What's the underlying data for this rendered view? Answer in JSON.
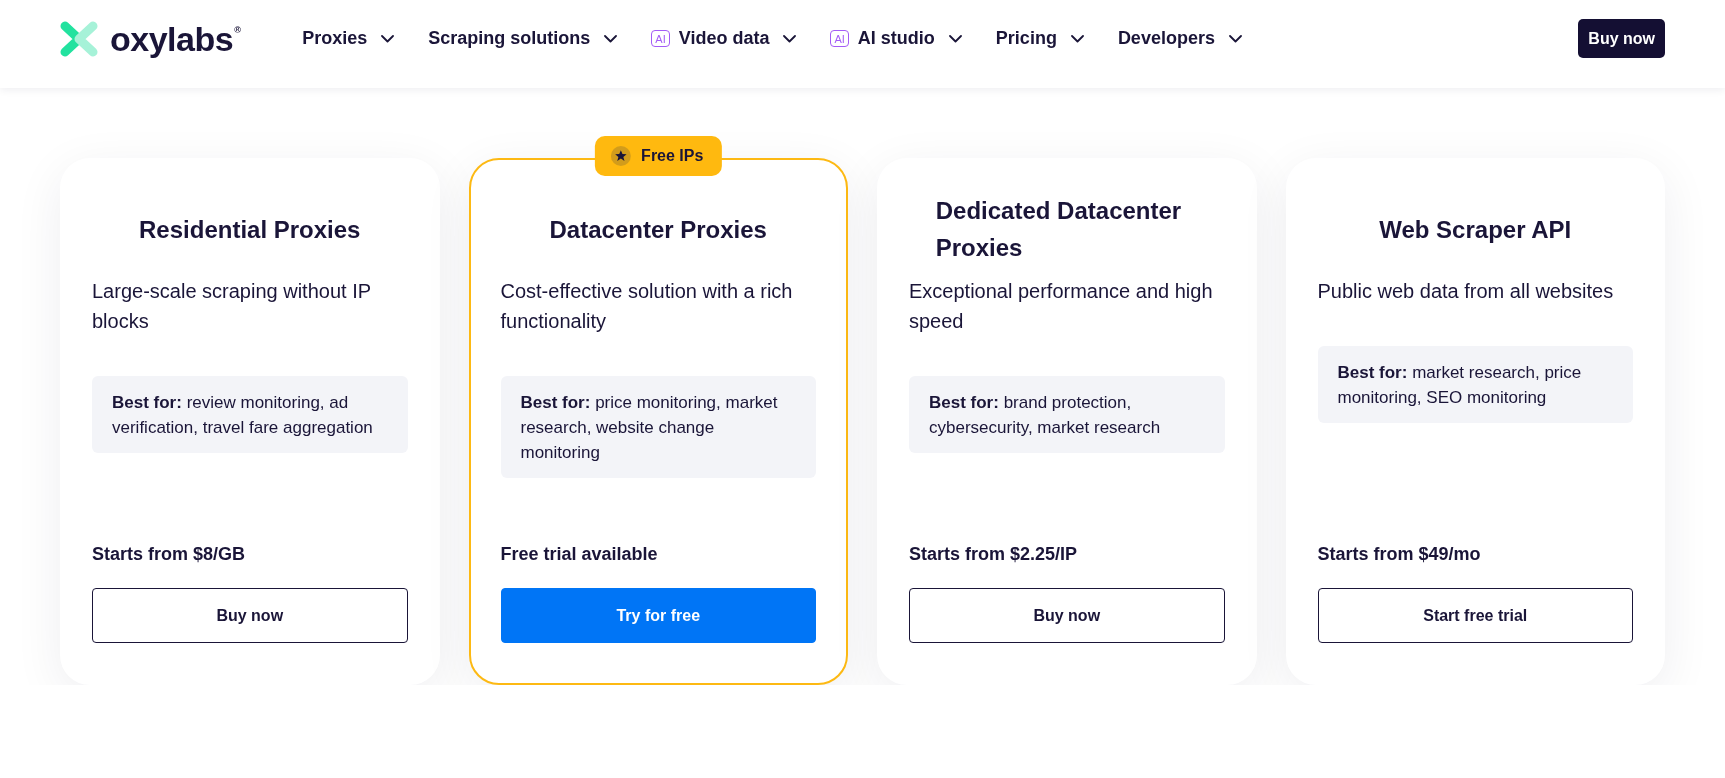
{
  "header": {
    "logo": {
      "text": "oxylabs$^{®}$"
    },
    "nav": [
      {
        "label": "Proxies"
      },
      {
        "label": "Scraping solutions"
      },
      {
        "label": "Video data",
        "tag": "AI"
      },
      {
        "label": "AI studio",
        "tag": "AI"
      },
      {
        "label": "Pricing"
      },
      {
        "label": "Developers"
      }
    ],
    "cta": "Buy now"
  },
  "plans": [
    {
      "title": "Residential Proxies",
      "description": "Large-scale scraping without IP blocks",
      "best_for": "**Best for:** review monitoring, ad verification, travel fare aggregation",
      "price": "Starts from $8/GB",
      "button": {
        "label": "Buy now",
        "kind": "outline"
      },
      "highlighted": false
    },
    {
      "title": "Datacenter Proxies",
      "badge": "Free IPs",
      "description": "Cost-effective solution with a rich functionality",
      "best_for": "**Best for:** price monitoring, market research, website change monitoring",
      "price": "Free trial available",
      "button": {
        "label": "Try for free",
        "kind": "primary"
      },
      "highlighted": true
    },
    {
      "title": "Dedicated Datacenter Proxies",
      "description": "Exceptional performance and high speed",
      "best_for": "**Best for:** brand protection, cybersecurity, market research",
      "price": "Starts from $2.25/IP",
      "button": {
        "label": "Buy now",
        "kind": "outline"
      },
      "highlighted": false
    },
    {
      "title": "Web Scraper API",
      "description": "Public web data from all websites",
      "best_for": "**Best for:** market research, price monitoring, SEO monitoring",
      "price": "Starts from $49/mo",
      "button": {
        "label": "Start free trial",
        "kind": "outline"
      },
      "highlighted": false
    }
  ]
}
